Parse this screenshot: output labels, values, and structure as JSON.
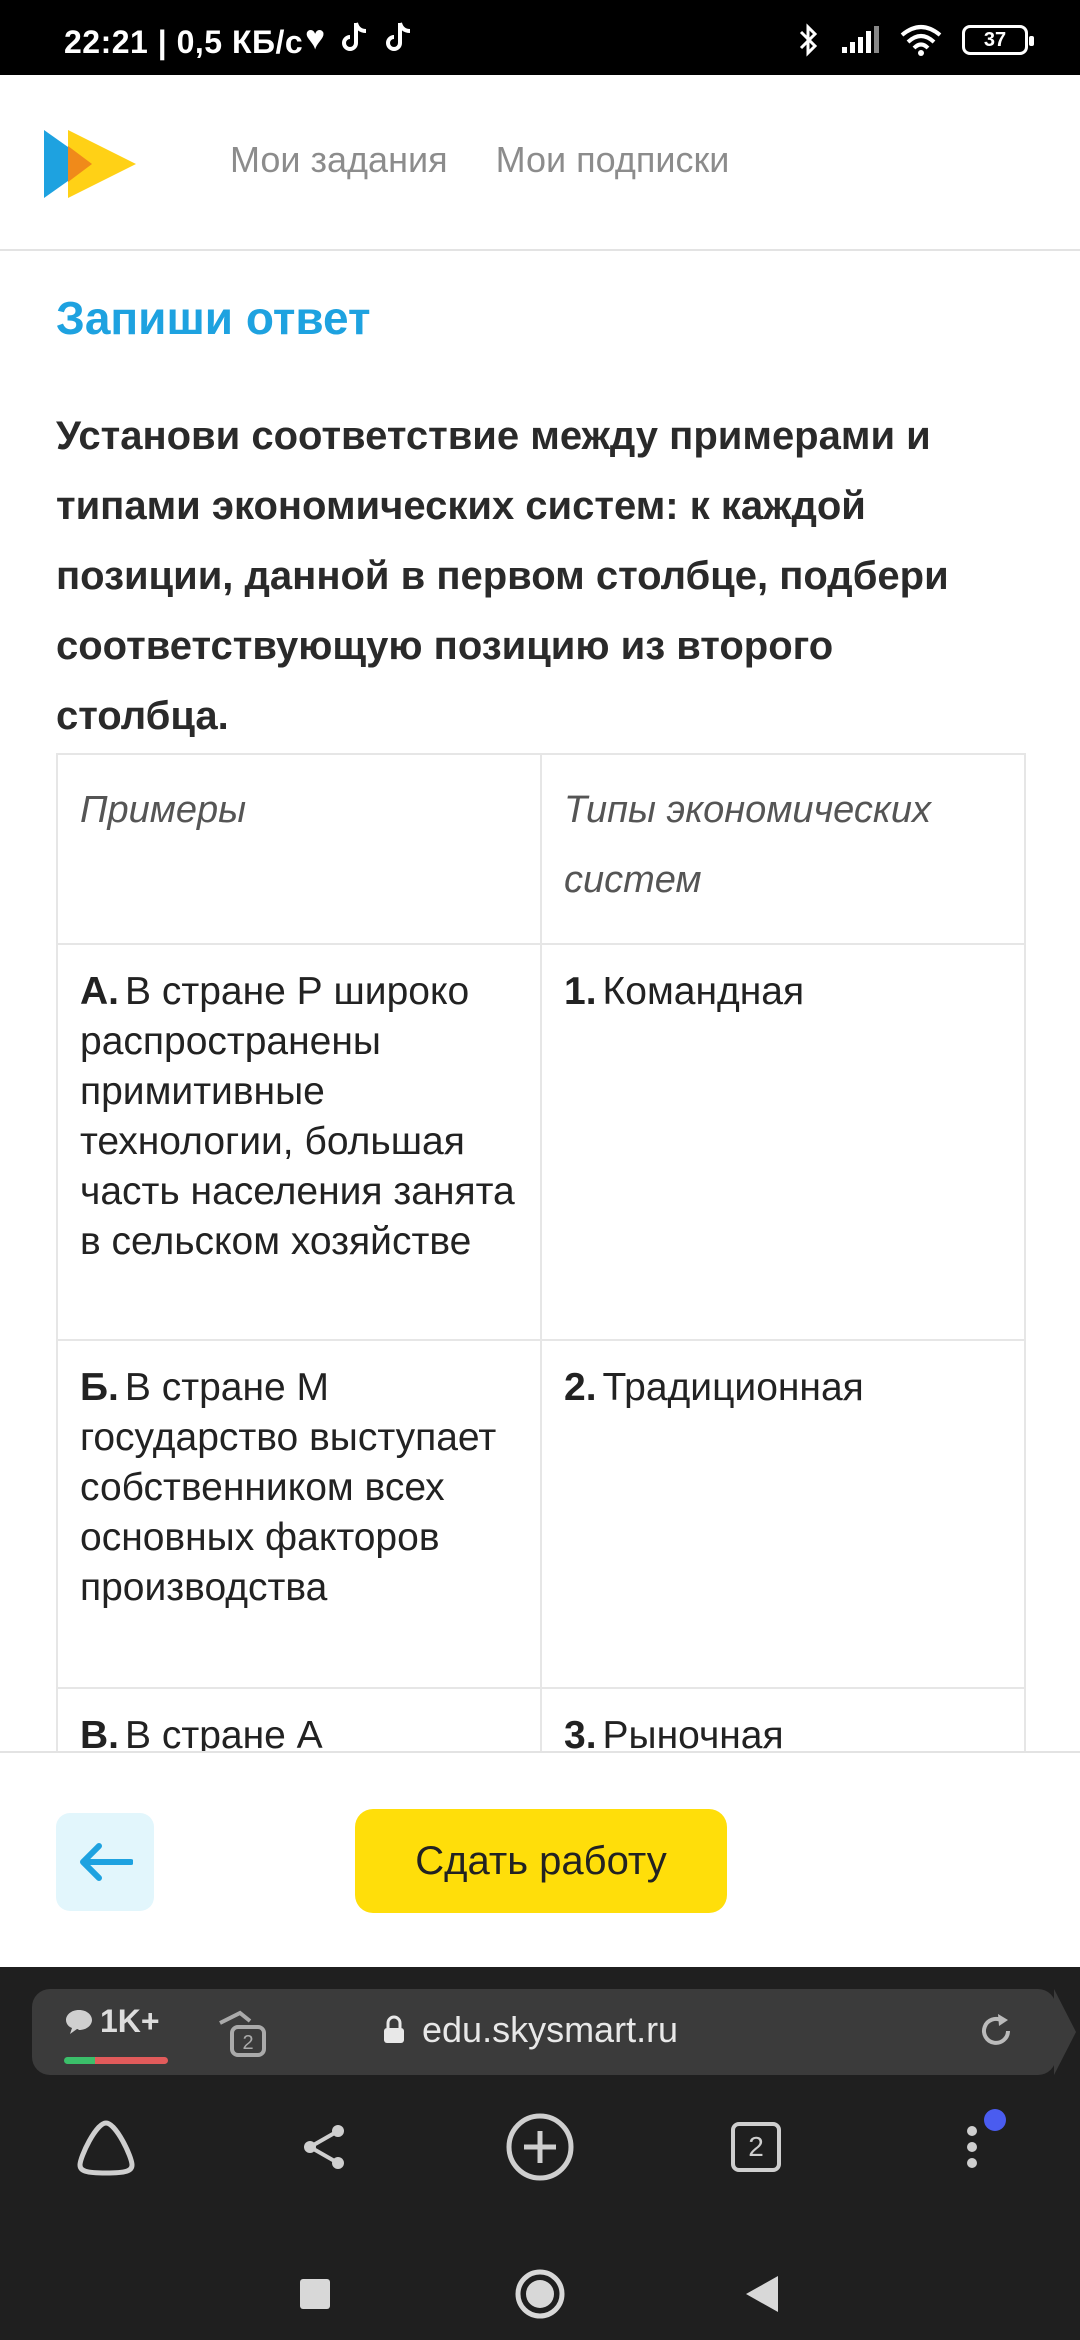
{
  "status_bar": {
    "time": "22:21",
    "network_info": "| 0,5 КБ/с",
    "battery": "37",
    "icons": [
      "heart-icon",
      "tiktok-icon",
      "tiktok-icon",
      "bluetooth-icon",
      "signal-icon",
      "wifi-icon",
      "battery-icon"
    ]
  },
  "header": {
    "nav": [
      "Мои задания",
      "Мои подписки"
    ]
  },
  "task": {
    "heading": "Запиши ответ",
    "instruction": "Установи соответствие между примерами и типами экономических систем: к каждой позиции, данной в первом столбце, подбери соответствующую позицию из второго столбца.",
    "table": {
      "headers": [
        "Примеры",
        "Типы экономических систем"
      ],
      "rows": [
        {
          "left_letter": "А.",
          "left_text": "В стране Р широко распространены примитивные технологии, большая часть населения занята в сельском хозяйстве",
          "right_num": "1.",
          "right_text": "Командная"
        },
        {
          "left_letter": "Б.",
          "left_text": "В стране М государство выступает собственником всех основных факторов производства",
          "right_num": "2.",
          "right_text": "Традиционная"
        },
        {
          "left_letter": "В.",
          "left_text": "В стране А",
          "right_num": "3.",
          "right_text": "Рыночная"
        }
      ]
    }
  },
  "actions": {
    "submit_label": "Сдать работу"
  },
  "browser": {
    "comments_count": "1K+",
    "small_tab_count": "2",
    "url": "edu.skysmart.ru",
    "tab_count": "2"
  },
  "colors": {
    "accent_blue": "#1ea2e0",
    "submit_yellow": "#ffde0a",
    "back_button_bg": "#e2f6fc"
  }
}
